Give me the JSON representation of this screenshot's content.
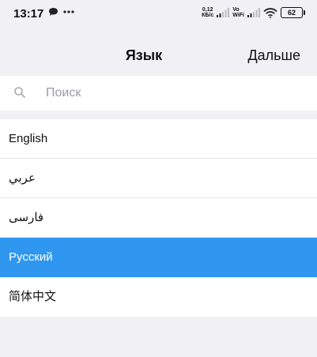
{
  "status_bar": {
    "time": "13:17",
    "speed_value": "0,12",
    "speed_unit": "КБ/с",
    "vowifi_top": "Vo",
    "vowifi_bottom": "WiFi",
    "battery": "62"
  },
  "nav": {
    "title": "Язык",
    "next_label": "Дальше"
  },
  "search": {
    "placeholder": "Поиск",
    "value": ""
  },
  "languages": {
    "items": [
      {
        "label": "English"
      },
      {
        "label": "عربي"
      },
      {
        "label": "فارسی"
      },
      {
        "label": "Русский"
      },
      {
        "label": "简体中文"
      }
    ],
    "selected": "Русский"
  },
  "colors": {
    "background": "#f0f0f5",
    "selected": "#2f97f0",
    "placeholder": "#9b9ba3"
  },
  "icons": {
    "search": "search-icon",
    "chat": "chat-bubble-icon",
    "more": "more-dots-icon",
    "signal": "signal-icon",
    "wifi": "wifi-icon",
    "battery": "battery-icon"
  }
}
